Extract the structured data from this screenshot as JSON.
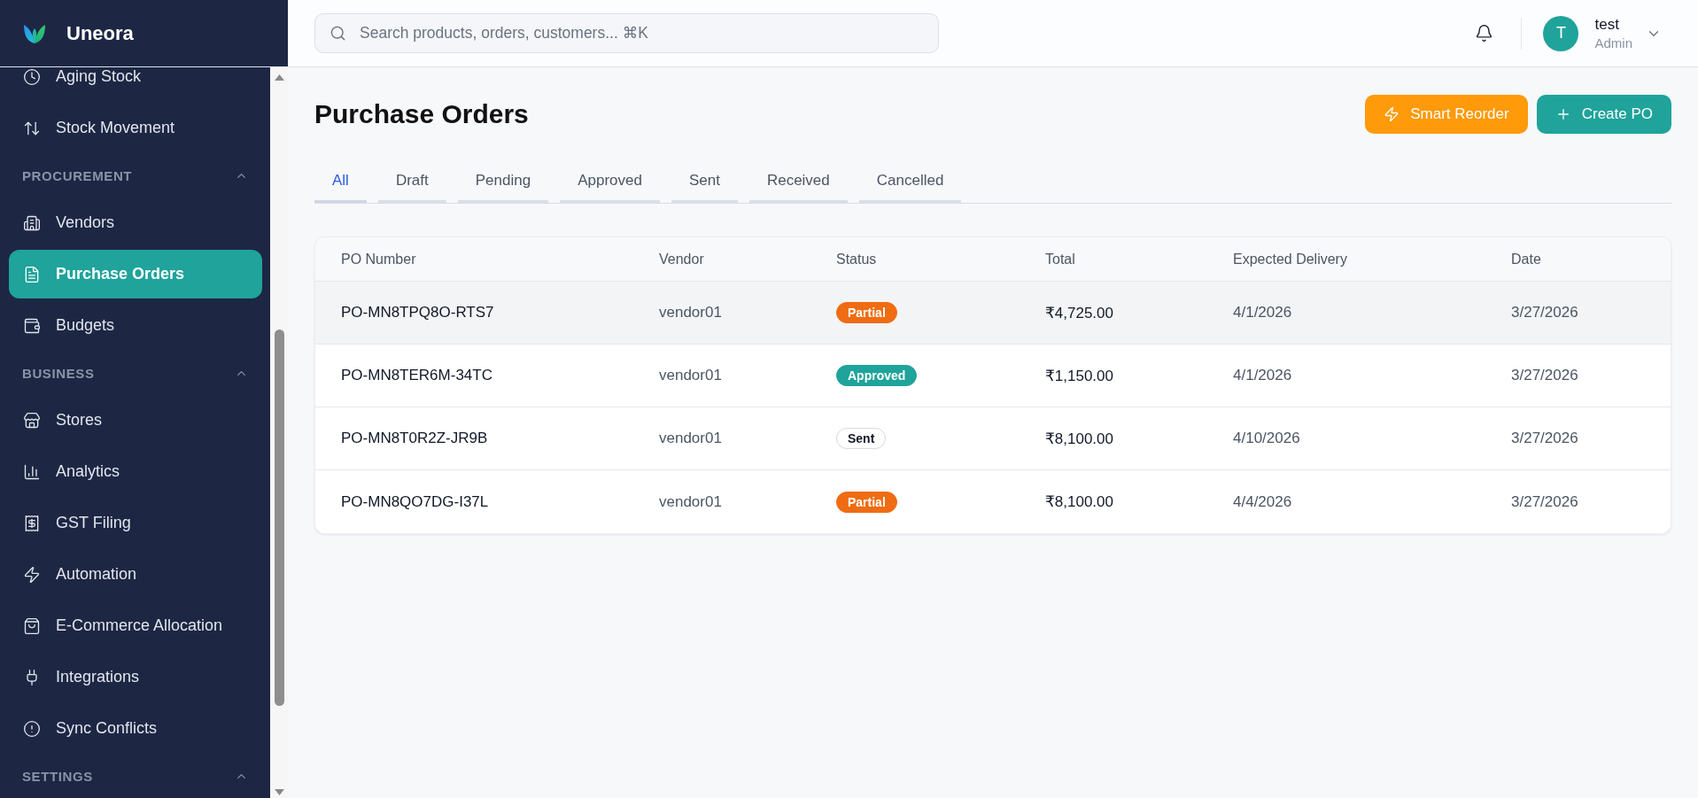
{
  "brand": {
    "name": "Uneora"
  },
  "sidebar": {
    "groups": [
      {
        "items": [
          {
            "label": "Aging Stock",
            "selected": false
          },
          {
            "label": "Stock Movement",
            "selected": false
          }
        ]
      },
      {
        "title": "PROCUREMENT",
        "expanded": true,
        "items": [
          {
            "label": "Vendors",
            "selected": false
          },
          {
            "label": "Purchase Orders",
            "selected": true
          },
          {
            "label": "Budgets",
            "selected": false
          }
        ]
      },
      {
        "title": "BUSINESS",
        "expanded": true,
        "items": [
          {
            "label": "Stores",
            "selected": false
          },
          {
            "label": "Analytics",
            "selected": false
          },
          {
            "label": "GST Filing",
            "selected": false
          },
          {
            "label": "Automation",
            "selected": false
          },
          {
            "label": "E-Commerce Allocation",
            "selected": false
          },
          {
            "label": "Integrations",
            "selected": false
          },
          {
            "label": "Sync Conflicts",
            "selected": false
          }
        ]
      },
      {
        "title": "SETTINGS",
        "expanded": true
      }
    ]
  },
  "header": {
    "search": {
      "placeholder": "Search products, orders, customers... ⌘K"
    },
    "user": {
      "initial": "T",
      "name": "test",
      "role": "Admin"
    }
  },
  "page": {
    "title": "Purchase Orders",
    "actions": [
      {
        "label": "Smart Reorder",
        "kind": "smart"
      },
      {
        "label": "Create PO",
        "kind": "create"
      }
    ]
  },
  "tabs": [
    {
      "label": "All",
      "selected": true
    },
    {
      "label": "Draft",
      "selected": false
    },
    {
      "label": "Pending",
      "selected": false
    },
    {
      "label": "Approved",
      "selected": false
    },
    {
      "label": "Sent",
      "selected": false
    },
    {
      "label": "Received",
      "selected": false
    },
    {
      "label": "Cancelled",
      "selected": false
    }
  ],
  "table": {
    "columns": [
      "PO Number",
      "Vendor",
      "Status",
      "Total",
      "Expected Delivery",
      "Date"
    ],
    "rows": [
      {
        "highlighted": true,
        "po_number": "PO-MN8TPQ8O-RTS7",
        "vendor": "vendor01",
        "status": {
          "label": "Partial",
          "kind": "partial"
        },
        "total": "₹4,725.00",
        "expected_delivery": "4/1/2026",
        "date": "3/27/2026"
      },
      {
        "highlighted": false,
        "po_number": "PO-MN8TER6M-34TC",
        "vendor": "vendor01",
        "status": {
          "label": "Approved",
          "kind": "approved"
        },
        "total": "₹1,150.00",
        "expected_delivery": "4/1/2026",
        "date": "3/27/2026"
      },
      {
        "highlighted": false,
        "po_number": "PO-MN8T0R2Z-JR9B",
        "vendor": "vendor01",
        "status": {
          "label": "Sent",
          "kind": "sent"
        },
        "total": "₹8,100.00",
        "expected_delivery": "4/10/2026",
        "date": "3/27/2026"
      },
      {
        "highlighted": false,
        "po_number": "PO-MN8QO7DG-I37L",
        "vendor": "vendor01",
        "status": {
          "label": "Partial",
          "kind": "partial"
        },
        "total": "₹8,100.00",
        "expected_delivery": "4/4/2026",
        "date": "3/27/2026"
      }
    ]
  }
}
